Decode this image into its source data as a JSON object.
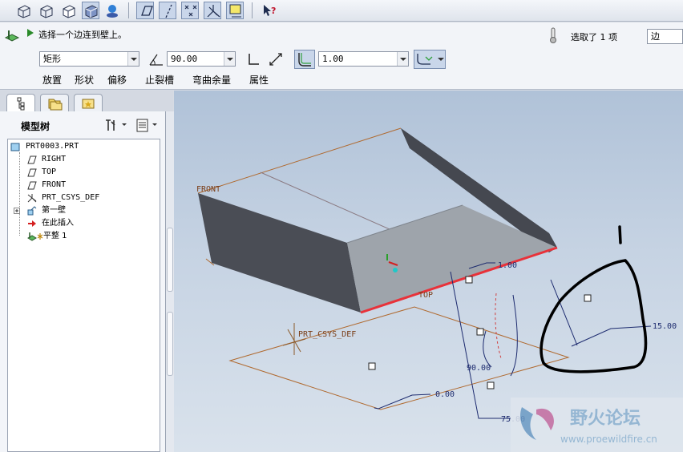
{
  "toolbar": {
    "buttons": [
      {
        "name": "display-wireframe-button",
        "icon": "wireframe-cube-icon"
      },
      {
        "name": "display-hidden-line-button",
        "icon": "hidden-line-cube-icon"
      },
      {
        "name": "display-no-hidden-button",
        "icon": "no-hidden-cube-icon"
      },
      {
        "name": "display-shading-button",
        "icon": "shaded-cube-icon",
        "pressed": true
      },
      {
        "name": "saved-views-button",
        "icon": "view-orient-icon"
      },
      {
        "name": "datum-planes-toggle",
        "icon": "datum-plane-icon",
        "pressed": true
      },
      {
        "name": "datum-axes-toggle",
        "icon": "datum-axis-icon",
        "pressed": true
      },
      {
        "name": "datum-points-toggle",
        "icon": "datum-point-icon",
        "pressed": true
      },
      {
        "name": "coordinate-systems-toggle",
        "icon": "csys-icon",
        "pressed": true
      },
      {
        "name": "annotations-toggle",
        "icon": "annotation-icon",
        "pressed": true
      },
      {
        "name": "context-help-button",
        "icon": "help-cursor-icon"
      }
    ]
  },
  "dashboard": {
    "prompt": "选择一个边连到壁上。",
    "selection_status": "选取了 1 项",
    "selection_filter": "边",
    "shape": "矩形",
    "angle": "90.00",
    "thickness_value": "1.00",
    "tabs": [
      "放置",
      "形状",
      "偏移",
      "止裂槽",
      "弯曲余量",
      "属性"
    ]
  },
  "tree": {
    "title": "模型树",
    "items": [
      {
        "label": "PRT0003.PRT",
        "icon": "part-icon",
        "indent": 0
      },
      {
        "label": "RIGHT",
        "icon": "datum-plane-icon",
        "indent": 1
      },
      {
        "label": "TOP",
        "icon": "datum-plane-icon",
        "indent": 1
      },
      {
        "label": "FRONT",
        "icon": "datum-plane-icon",
        "indent": 1
      },
      {
        "label": "PRT_CSYS_DEF",
        "icon": "csys-icon",
        "indent": 1
      },
      {
        "label": "第一壁",
        "icon": "first-wall-icon",
        "indent": 1,
        "expandable": true
      },
      {
        "label": "在此插入",
        "icon": "insert-here-arrow-icon",
        "indent": 1
      },
      {
        "label": "平整 1",
        "icon": "flat-wall-icon",
        "indent": 1
      }
    ]
  },
  "viewport": {
    "labels": {
      "front": "FRONT",
      "top": "TOP",
      "csys": "PRT_CSYS_DEF",
      "thickness_dim": "1.00",
      "dim_angle": "90.00",
      "dim_length": "75.00",
      "dim_offset": "0.00",
      "dim_height": "15.00"
    },
    "colors": {
      "selected_edge": "#e8323a",
      "wall_dark": "#4a4d55",
      "floor": "#9ea4ab",
      "datum": "#b06a30",
      "dimension": "#1c2a6e",
      "freehand_circle": "#000000"
    }
  },
  "watermark": {
    "title": "野火论坛",
    "url": "www.proewildfire.cn"
  }
}
